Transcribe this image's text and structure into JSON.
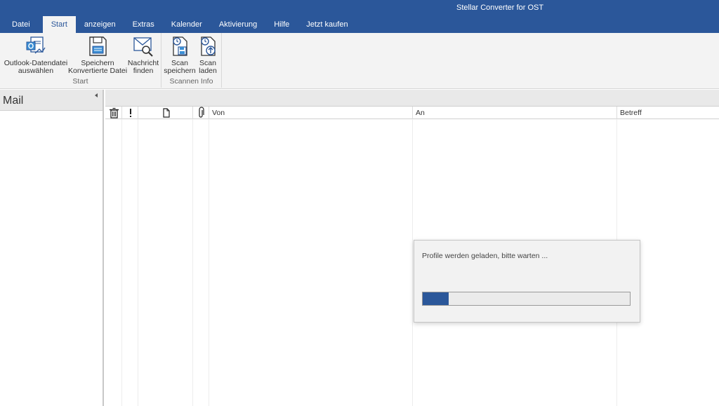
{
  "app": {
    "title": "Stellar Converter for OST"
  },
  "tabs": [
    {
      "label": "Datei"
    },
    {
      "label": "Start"
    },
    {
      "label": "anzeigen"
    },
    {
      "label": "Extras"
    },
    {
      "label": "Kalender"
    },
    {
      "label": "Aktivierung"
    },
    {
      "label": "Hilfe"
    },
    {
      "label": "Jetzt kaufen"
    }
  ],
  "active_tab": "Start",
  "ribbon": {
    "groups": [
      {
        "label": "Start",
        "buttons": [
          {
            "line1": "Outlook-Datendatei",
            "line2": "auswählen",
            "icon": "outlook-file-icon"
          },
          {
            "line1": "Speichern",
            "line2": "Konvertierte Datei",
            "icon": "save-icon"
          },
          {
            "line1": "Nachricht",
            "line2": "finden",
            "icon": "find-message-icon"
          }
        ]
      },
      {
        "label": "Scannen Info",
        "buttons": [
          {
            "line1": "Scan",
            "line2": "speichern",
            "icon": "save-scan-icon"
          },
          {
            "line1": "Scan",
            "line2": "laden",
            "icon": "load-scan-icon"
          }
        ]
      }
    ]
  },
  "left_pane": {
    "title": "Mail"
  },
  "columns": [
    {
      "label": "",
      "icon": "trash-icon"
    },
    {
      "label": "",
      "icon": "exclamation-icon"
    },
    {
      "label": "",
      "icon": "document-icon"
    },
    {
      "label": "",
      "icon": "paperclip-icon"
    },
    {
      "label": "Von"
    },
    {
      "label": "An"
    },
    {
      "label": "Betreff"
    }
  ],
  "dialog": {
    "message": "Profile werden geladen, bitte warten ...",
    "progress": 0.125
  },
  "colors": {
    "accent": "#2b579a",
    "ribbon_bg": "#f3f3f3"
  }
}
